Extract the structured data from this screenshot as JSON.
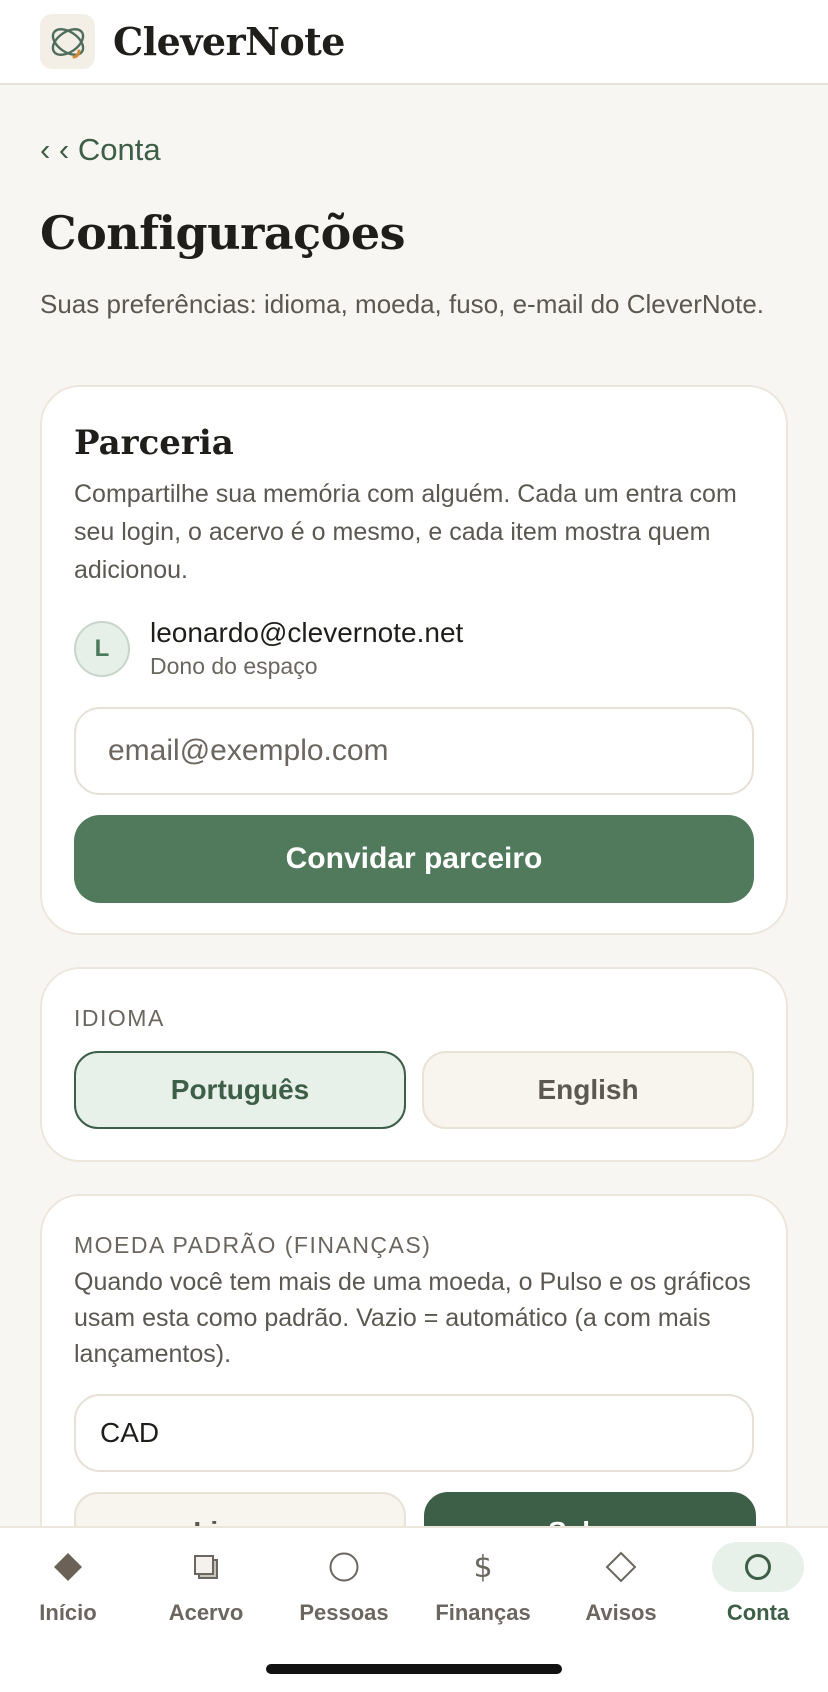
{
  "app": {
    "name": "CleverNote"
  },
  "nav": {
    "back_label": "‹ ‹ Conta"
  },
  "page": {
    "title": "Configurações",
    "subtitle": "Suas preferências: idioma, moeda, fuso, e-mail do CleverNote."
  },
  "partner": {
    "title": "Parceria",
    "description": "Compartilhe sua memória com alguém. Cada um entra com seu login, o acervo é o mesmo, e cada item mostra quem adicionou.",
    "owner": {
      "initial": "L",
      "email": "leonardo@clevernote.net",
      "role": "Dono do espaço"
    },
    "email_placeholder": "email@exemplo.com",
    "invite_label": "Convidar parceiro"
  },
  "language": {
    "label": "IDIOMA",
    "options": [
      "Português",
      "English"
    ],
    "selected": "Português"
  },
  "currency": {
    "label": "MOEDA PADRÃO (FINANÇAS)",
    "description": "Quando você tem mais de uma moeda, o Pulso e os gráficos usam esta como padrão. Vazio = automático (a com mais lançamentos).",
    "value": "CAD",
    "clear_label": "Limpar",
    "save_label": "Salvar"
  },
  "tabs": [
    {
      "label": "Início",
      "icon": "diamond-filled-icon"
    },
    {
      "label": "Acervo",
      "icon": "stack-icon"
    },
    {
      "label": "Pessoas",
      "icon": "circle-outline-icon"
    },
    {
      "label": "Finanças",
      "icon": "dollar-icon"
    },
    {
      "label": "Avisos",
      "icon": "diamond-outline-icon"
    },
    {
      "label": "Conta",
      "icon": "circle-outline-icon"
    }
  ],
  "active_tab": "Conta",
  "colors": {
    "accent": "#517a5d",
    "accent_dark": "#3d5e47",
    "background": "#f8f6f2",
    "card": "#ffffff"
  }
}
